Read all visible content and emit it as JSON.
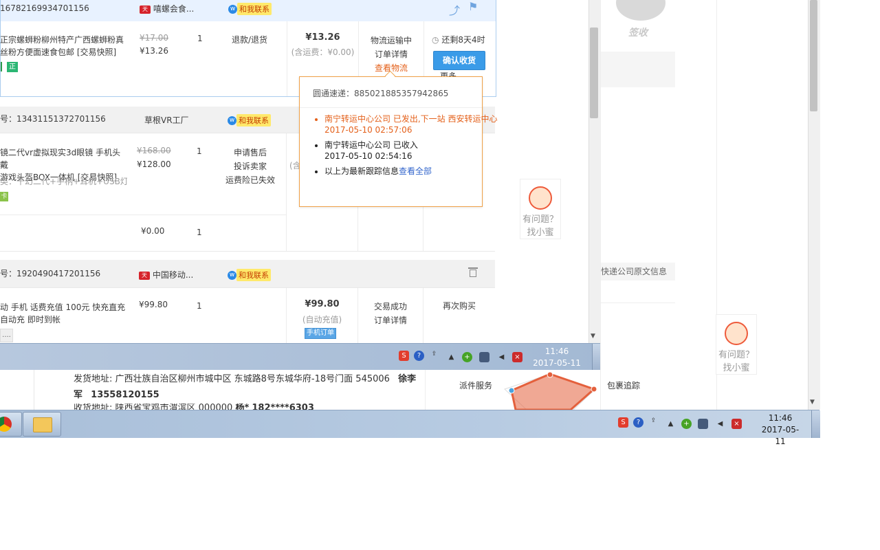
{
  "back_window": {
    "sign_label": "签收",
    "helper_line1": "有问题？",
    "helper_line2": "找小蜜",
    "courier_original_text": "快递公司原文信息",
    "ship_address_label": "发货地址:",
    "ship_address_value": "广西壮族自治区柳州市城中区 东城路8号东城华府-18号门面 545006",
    "ship_name": "徐李军",
    "ship_phone": "13558120155",
    "receive_address_label": "收货地址:",
    "receive_address_value": "陕西省宝鸡市渭滨区 000000",
    "receive_name": "杨*",
    "receive_phone": "182****6303",
    "radar_label_left": "派件服务",
    "radar_label_right": "包裹追踪"
  },
  "front_window": {
    "orders": [
      {
        "order_no": "16782169934701156",
        "shop": "嘻螺会食...",
        "contact": "和我联系",
        "title_line1": "正宗螺蛳粉柳州特产广西螺蛳粉真",
        "title_line2": "丝粉方便面速食包邮 [交易快照]",
        "badge": "正",
        "price_original": "¥17.00",
        "price_now": "¥13.26",
        "qty": "1",
        "after_sale": "退款/退货",
        "total": "¥13.26",
        "total_note": "(含运费：¥0.00)",
        "status_line1": "物流运输中",
        "status_line2": "订单详情",
        "status_line3": "查看物流",
        "remaining": "还剩8天4时",
        "confirm": "确认收货",
        "more": "更多"
      },
      {
        "order_no": "13431151372701156",
        "order_prefix": "号：",
        "shop": "草根VR工厂",
        "contact": "和我联系",
        "title_line1": "镜二代vr虚拟现实3d眼镜 手机头戴",
        "title_line2": "游戏头盔BOX一体机 [交易快照]",
        "sku": "类：千幻二代+手柄+耳机+USB灯",
        "badge": "卡",
        "price_original": "¥168.00",
        "price_now": "¥128.00",
        "qty": "1",
        "after_sale_line1": "申请售后",
        "after_sale_line2": "投诉卖家",
        "after_sale_line3": "运费险已失效",
        "total_partial": "(含",
        "extra_price": "¥0.00",
        "extra_qty": "1"
      },
      {
        "order_no": "1920490417201156",
        "order_prefix": "号：",
        "shop": "中国移动...",
        "contact": "和我联系",
        "title_line1": "动 手机 话费充值 100元 快充直充",
        "title_line2": "自动充 即时到帐",
        "price_now": "¥99.80",
        "qty": "1",
        "total": "¥99.80",
        "total_note": "(自动充值)",
        "mobile_tag": "手机订单",
        "status_line1": "交易成功",
        "status_line2": "订单详情",
        "rebuy": "再次购买",
        "more_ellipsis": "...."
      }
    ],
    "logistics_popup": {
      "courier": "圆通速递：",
      "tracking_no": "885021885357942865",
      "events": [
        {
          "text": "南宁转运中心公司 已发出,下一站 西安转运中心",
          "time": "2017-05-10 02:57:06",
          "latest": true
        },
        {
          "text": "南宁转运中心公司 已收入",
          "time": "2017-05-10 02:54:16",
          "latest": false
        }
      ],
      "footer_text": "以上为最新跟踪信息",
      "footer_link": "查看全部"
    },
    "helper_line1": "有问题？",
    "helper_line2": "找小蜜"
  },
  "front_taskbar": {
    "time": "11:46",
    "date": "2017-05-11"
  },
  "back_taskbar": {
    "time": "11:46",
    "date": "2017-05-11"
  },
  "colors": {
    "accent_blue": "#3a9be8",
    "orange": "#e4601a",
    "taskbar": "#a9bfd9"
  }
}
